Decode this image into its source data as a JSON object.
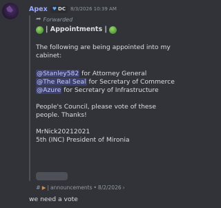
{
  "message": {
    "username": "Apex",
    "tag_label": "DC",
    "timestamp": "8/3/2026 10:39 AM",
    "forwarded_label": "Forwarded"
  },
  "forwarded_content": {
    "title": "| Appointments |",
    "intro": "The following are being appointed into my cabinet:",
    "appointments": [
      {
        "mention": "@Stanley582",
        "role": " for Attorney General"
      },
      {
        "mention": "@The Real Seal",
        "role": " for Secretary of Commerce"
      },
      {
        "mention": "@Azure",
        "role": " for Secretary of Infrastructure"
      }
    ],
    "call_to_vote": "People's Council, please vote of these people. Thanks!",
    "signature_name": "MrNick20212021",
    "signature_title": "5th (INC) President of Mironia"
  },
  "source": {
    "channel": "announcements",
    "date": "8/2/2026"
  },
  "reply_text": "we need a vote",
  "colors": {
    "background": "#313338",
    "username": "#9aa6ff",
    "mention_bg": "#5865f2",
    "muted": "#949ba4"
  },
  "icons": {
    "title_left": "globe-icon",
    "title_right": "globe-icon",
    "forwarded": "forward-arrow-icon",
    "source_channel": "hash-icon",
    "announcement": "megaphone-icon",
    "tag": "heart-icon"
  }
}
